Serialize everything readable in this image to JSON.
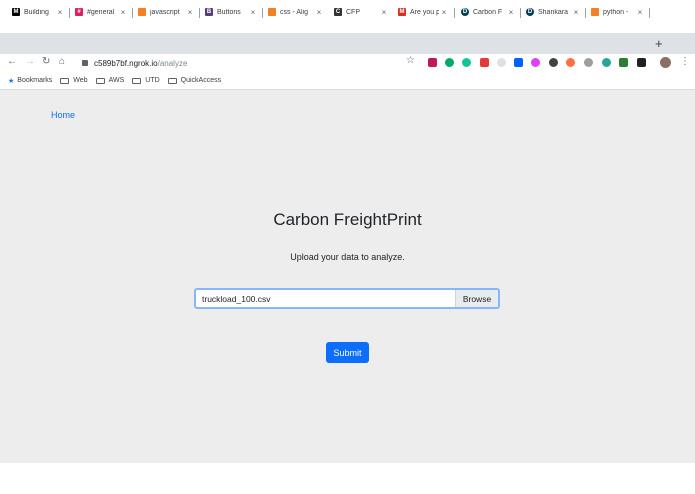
{
  "browser": {
    "tabs": [
      {
        "label": "Building",
        "icon": "medium-icon",
        "color": "#000000"
      },
      {
        "label": "#general",
        "icon": "slack-icon",
        "color": "#e01e5a"
      },
      {
        "label": "javascript",
        "icon": "stackoverflow-icon",
        "color": "#f48024"
      },
      {
        "label": "Buttons",
        "icon": "bootstrap-icon",
        "color": "#563d7c"
      },
      {
        "label": "css - Alig",
        "icon": "stackoverflow-icon",
        "color": "#f48024"
      },
      {
        "label": "CFP",
        "icon": "cfp-icon",
        "color": "#333333"
      },
      {
        "label": "Are you p",
        "icon": "gmail-icon",
        "color": "#d93025"
      },
      {
        "label": "Carbon F",
        "icon": "devpost-icon",
        "color": "#003e54"
      },
      {
        "label": "Shankara",
        "icon": "devpost-icon",
        "color": "#003e54"
      },
      {
        "label": "python -",
        "icon": "stackoverflow-icon",
        "color": "#f48024"
      }
    ],
    "address": {
      "host": "c589b7bf.ngrok.io",
      "path": "/analyze"
    },
    "bookmarks": {
      "bookmarks_label": "Bookmarks",
      "folders": [
        "Web",
        "AWS",
        "UTD",
        "QuickAccess"
      ]
    }
  },
  "page": {
    "home_link": "Home",
    "title": "Carbon FreightPrint",
    "subtitle": "Upload your data to analyze.",
    "file_name": "truckload_100.csv",
    "browse_label": "Browse",
    "submit_label": "Submit"
  },
  "colors": {
    "accent": "#0d6efd",
    "page_bg": "#ededed"
  }
}
